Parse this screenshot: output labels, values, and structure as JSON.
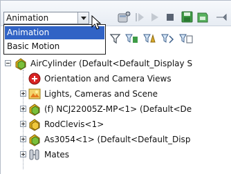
{
  "toolbar": {
    "study_type_selected": "Animation",
    "dropdown_options": [
      "Animation",
      "Basic Motion"
    ]
  },
  "tree": {
    "root": "AirCylinder  (Default<Default_Display S",
    "items": [
      "Orientation and Camera Views",
      "Lights, Cameras and Scene",
      "(f) NCJ22005Z-MP<1> (Default<De",
      "RodClevis<1>",
      "As3054<1> (Default<Default_Disp",
      "Mates"
    ]
  },
  "colors": {
    "selection": "#3163c5",
    "assembly_icon": "#e0b21c",
    "part_icon": "#7abf3a"
  }
}
